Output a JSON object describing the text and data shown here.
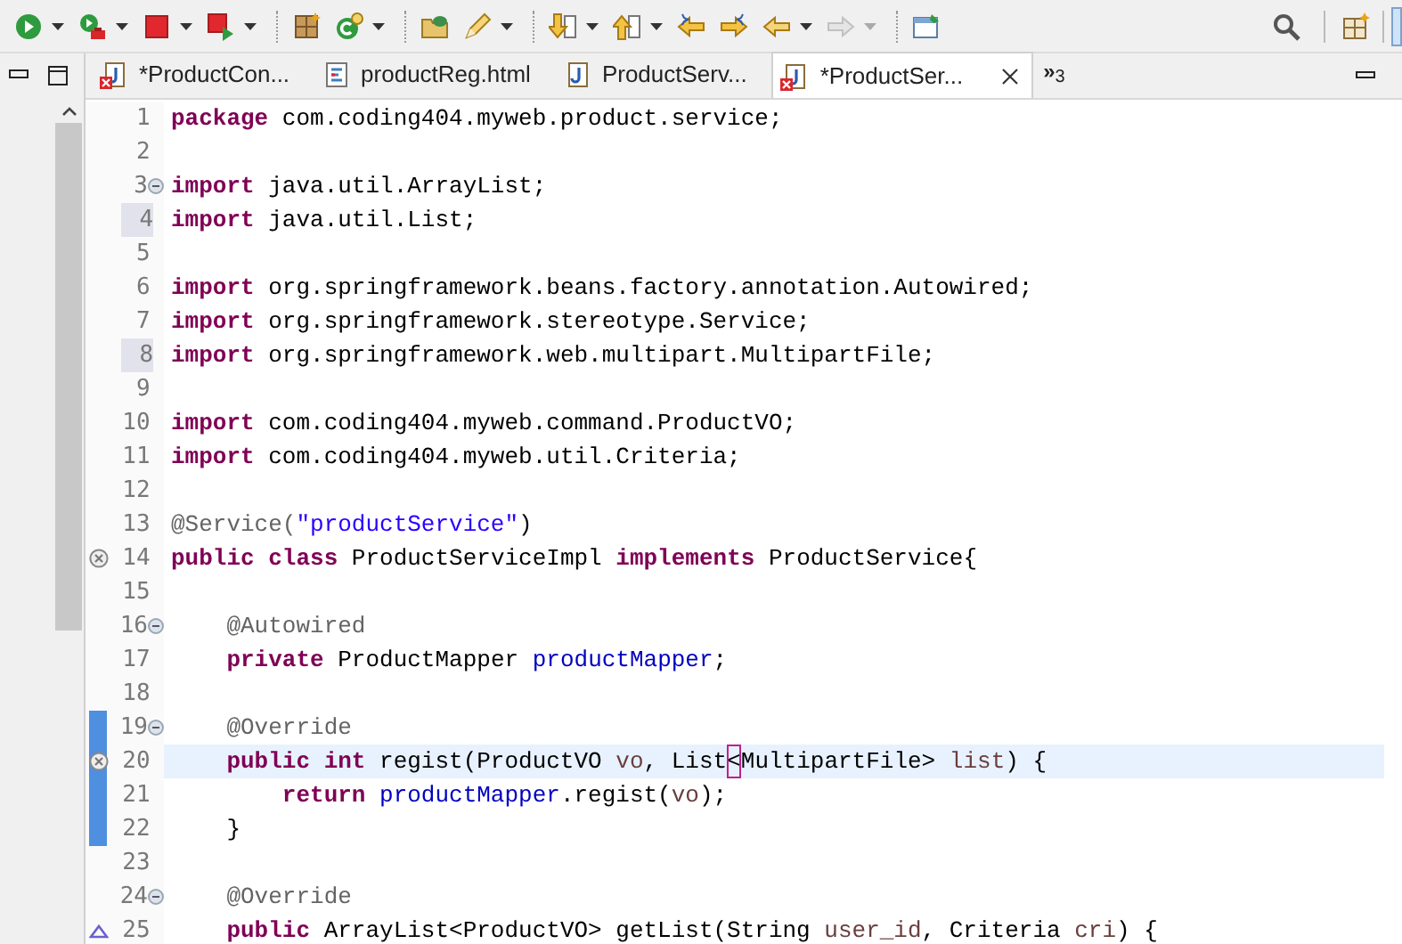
{
  "toolbar": [
    {
      "buttons": [
        {
          "kind": "run",
          "dropdown": true,
          "disabled": false
        },
        {
          "kind": "debug",
          "dropdown": true,
          "disabled": false
        },
        {
          "kind": "stop",
          "dropdown": true,
          "disabled": false
        },
        {
          "kind": "run-external",
          "dropdown": true,
          "disabled": false
        }
      ]
    },
    {
      "buttons": [
        {
          "kind": "package",
          "dropdown": false,
          "disabled": false
        },
        {
          "kind": "new-class",
          "dropdown": true,
          "disabled": false
        }
      ]
    },
    {
      "buttons": [
        {
          "kind": "open-folder",
          "dropdown": false,
          "disabled": false
        },
        {
          "kind": "pencil",
          "dropdown": true,
          "disabled": false
        }
      ]
    },
    {
      "buttons": [
        {
          "kind": "next-annotation",
          "dropdown": true,
          "disabled": false
        },
        {
          "kind": "prev-annotation",
          "dropdown": true,
          "disabled": false
        },
        {
          "kind": "back-edit",
          "dropdown": false,
          "disabled": false
        },
        {
          "kind": "forward-edit",
          "dropdown": false,
          "disabled": false
        },
        {
          "kind": "back",
          "dropdown": true,
          "disabled": false
        },
        {
          "kind": "forward",
          "dropdown": true,
          "disabled": true
        }
      ]
    },
    {
      "buttons": [
        {
          "kind": "pin-editor",
          "dropdown": false,
          "disabled": false
        }
      ]
    }
  ],
  "tabs": [
    {
      "label": "*ProductCon...",
      "kind": "java",
      "error": true,
      "selected": false
    },
    {
      "label": "productReg.html",
      "kind": "html",
      "error": false,
      "selected": false
    },
    {
      "label": "ProductServ...",
      "kind": "java",
      "error": false,
      "selected": false
    },
    {
      "label": "*ProductSer...",
      "kind": "java",
      "error": true,
      "selected": true
    }
  ],
  "hidden_tabs": {
    "chevron": "»",
    "count": "3"
  },
  "lines": [
    {
      "number": "1",
      "segments": [
        {
          "text": "package",
          "kind": "keyword"
        },
        {
          "text": " com.coding404.myweb.product.service;",
          "kind": "plain"
        }
      ]
    },
    {
      "number": "2"
    },
    {
      "number": "3",
      "fold": true,
      "segments": [
        {
          "text": "import",
          "kind": "keyword"
        },
        {
          "text": " java.util.ArrayList;",
          "kind": "plain"
        }
      ]
    },
    {
      "number": "4",
      "number_highlight": true,
      "segments": [
        {
          "text": "import",
          "kind": "keyword"
        },
        {
          "text": " java.util.List;",
          "kind": "plain"
        }
      ]
    },
    {
      "number": "5"
    },
    {
      "number": "6",
      "segments": [
        {
          "text": "import",
          "kind": "keyword"
        },
        {
          "text": " org.springframework.beans.factory.annotation.Autowired;",
          "kind": "plain"
        }
      ]
    },
    {
      "number": "7",
      "segments": [
        {
          "text": "import",
          "kind": "keyword"
        },
        {
          "text": " org.springframework.stereotype.Service;",
          "kind": "plain"
        }
      ]
    },
    {
      "number": "8",
      "number_highlight": true,
      "segments": [
        {
          "text": "import",
          "kind": "keyword"
        },
        {
          "text": " org.springframework.web.multipart.MultipartFile;",
          "kind": "plain"
        }
      ]
    },
    {
      "number": "9"
    },
    {
      "number": "10",
      "segments": [
        {
          "text": "import",
          "kind": "keyword"
        },
        {
          "text": " com.coding404.myweb.command.ProductVO;",
          "kind": "plain"
        }
      ]
    },
    {
      "number": "11",
      "segments": [
        {
          "text": "import",
          "kind": "keyword"
        },
        {
          "text": " com.coding404.myweb.util.Criteria;",
          "kind": "plain"
        }
      ]
    },
    {
      "number": "12"
    },
    {
      "number": "13",
      "segments": [
        {
          "text": "@Service(",
          "kind": "annotation"
        },
        {
          "text": "\"productService\"",
          "kind": "string"
        },
        {
          "text": ")",
          "kind": "plain"
        }
      ]
    },
    {
      "number": "14",
      "problem": {
        "kind": "error"
      },
      "segments": [
        {
          "text": "public class",
          "kind": "keyword"
        },
        {
          "text": " ProductServiceImpl ",
          "kind": "plain"
        },
        {
          "text": "implements",
          "kind": "keyword"
        },
        {
          "text": " ProductService{",
          "kind": "plain"
        }
      ]
    },
    {
      "number": "15"
    },
    {
      "number": "16",
      "fold": true,
      "segments": [
        {
          "text": "    @Autowired",
          "kind": "annotation"
        }
      ]
    },
    {
      "number": "17",
      "segments": [
        {
          "text": "    private",
          "kind": "keyword"
        },
        {
          "text": " ProductMapper ",
          "kind": "plain"
        },
        {
          "text": "productMapper",
          "kind": "field"
        },
        {
          "text": ";",
          "kind": "plain"
        }
      ]
    },
    {
      "number": "18"
    },
    {
      "number": "19",
      "fold": true,
      "changed": true,
      "segments": [
        {
          "text": "    @Override",
          "kind": "annotation"
        }
      ]
    },
    {
      "number": "20",
      "problem": {
        "kind": "error"
      },
      "changed": true,
      "current": true,
      "segments": [
        {
          "text": "    public int",
          "kind": "keyword"
        },
        {
          "text": " regist(ProductVO ",
          "kind": "plain"
        },
        {
          "text": "vo",
          "kind": "param"
        },
        {
          "text": ", List",
          "kind": "plain"
        },
        {
          "text": "<",
          "kind": "bracket"
        },
        {
          "text": "MultipartFile> ",
          "kind": "plain"
        },
        {
          "text": "list",
          "kind": "param"
        },
        {
          "text": ") {",
          "kind": "plain"
        }
      ]
    },
    {
      "number": "21",
      "changed": true,
      "segments": [
        {
          "text": "        return",
          "kind": "keyword"
        },
        {
          "text": " productMapper",
          "kind": "field"
        },
        {
          "text": ".regist(",
          "kind": "plain"
        },
        {
          "text": "vo",
          "kind": "param"
        },
        {
          "text": ");",
          "kind": "plain"
        }
      ]
    },
    {
      "number": "22",
      "changed": true,
      "segments": [
        {
          "text": "    }",
          "kind": "plain"
        }
      ]
    },
    {
      "number": "23"
    },
    {
      "number": "24",
      "fold": true,
      "segments": [
        {
          "text": "    @Override",
          "kind": "annotation"
        }
      ]
    },
    {
      "number": "25",
      "problem": {
        "kind": "warning"
      },
      "segments": [
        {
          "text": "    public",
          "kind": "keyword"
        },
        {
          "text": " ArrayList<ProductVO> getList(String ",
          "kind": "plain"
        },
        {
          "text": "user_id",
          "kind": "param"
        },
        {
          "text": ", Criteria ",
          "kind": "plain"
        },
        {
          "text": "cri",
          "kind": "param"
        },
        {
          "text": ") {",
          "kind": "plain"
        }
      ]
    }
  ]
}
